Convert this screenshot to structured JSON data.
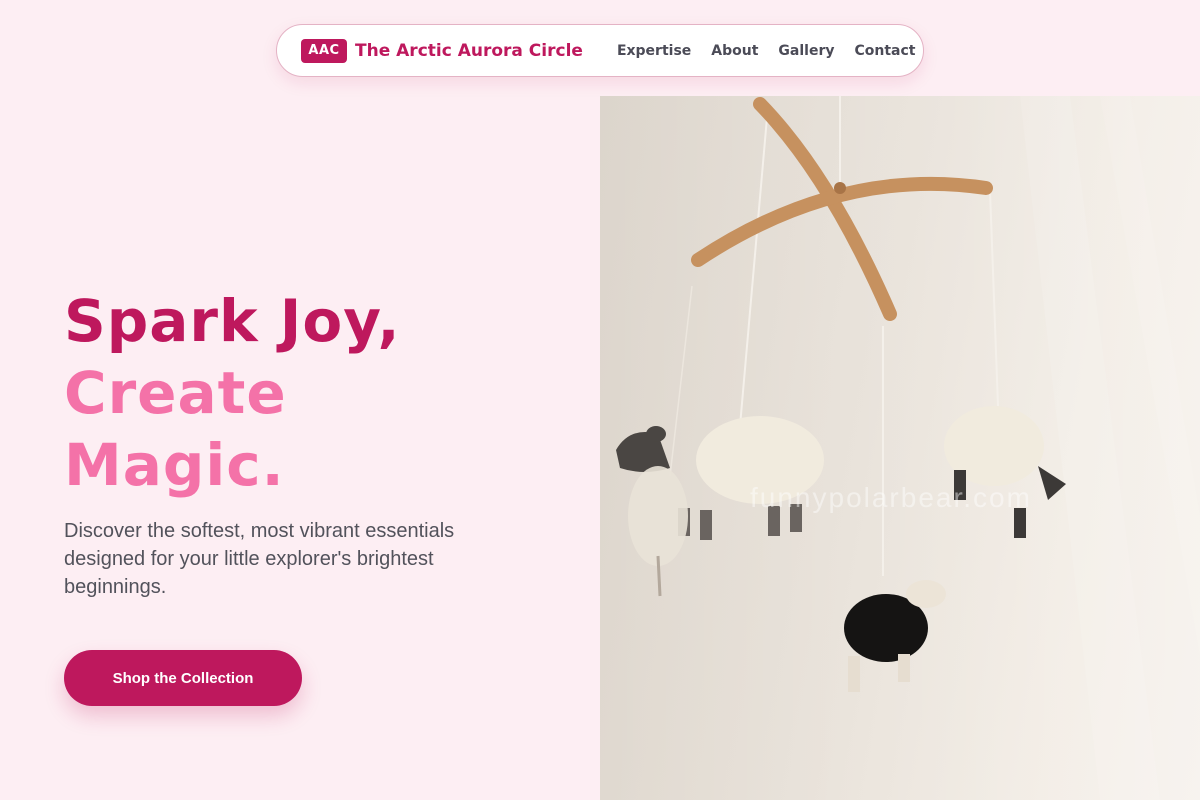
{
  "nav": {
    "logo_badge": "AAC",
    "brand_name": "The Arctic Aurora Circle",
    "links": [
      {
        "label": "Expertise"
      },
      {
        "label": "About"
      },
      {
        "label": "Gallery"
      },
      {
        "label": "Contact"
      }
    ]
  },
  "hero": {
    "title_line1": "Spark Joy,",
    "title_line2": "Create",
    "title_line3": "Magic.",
    "description": "Discover the softest, most vibrant essentials designed for your little explorer's brightest beginnings.",
    "cta_label": "Shop the Collection"
  },
  "image": {
    "subject": "sheep-mobile-photo",
    "watermark": "funnypolarbear.com"
  },
  "colors": {
    "page_bg": "#fdeef3",
    "brand": "#be185d",
    "accent_pink": "#f472a8",
    "body_text": "#52525b"
  }
}
